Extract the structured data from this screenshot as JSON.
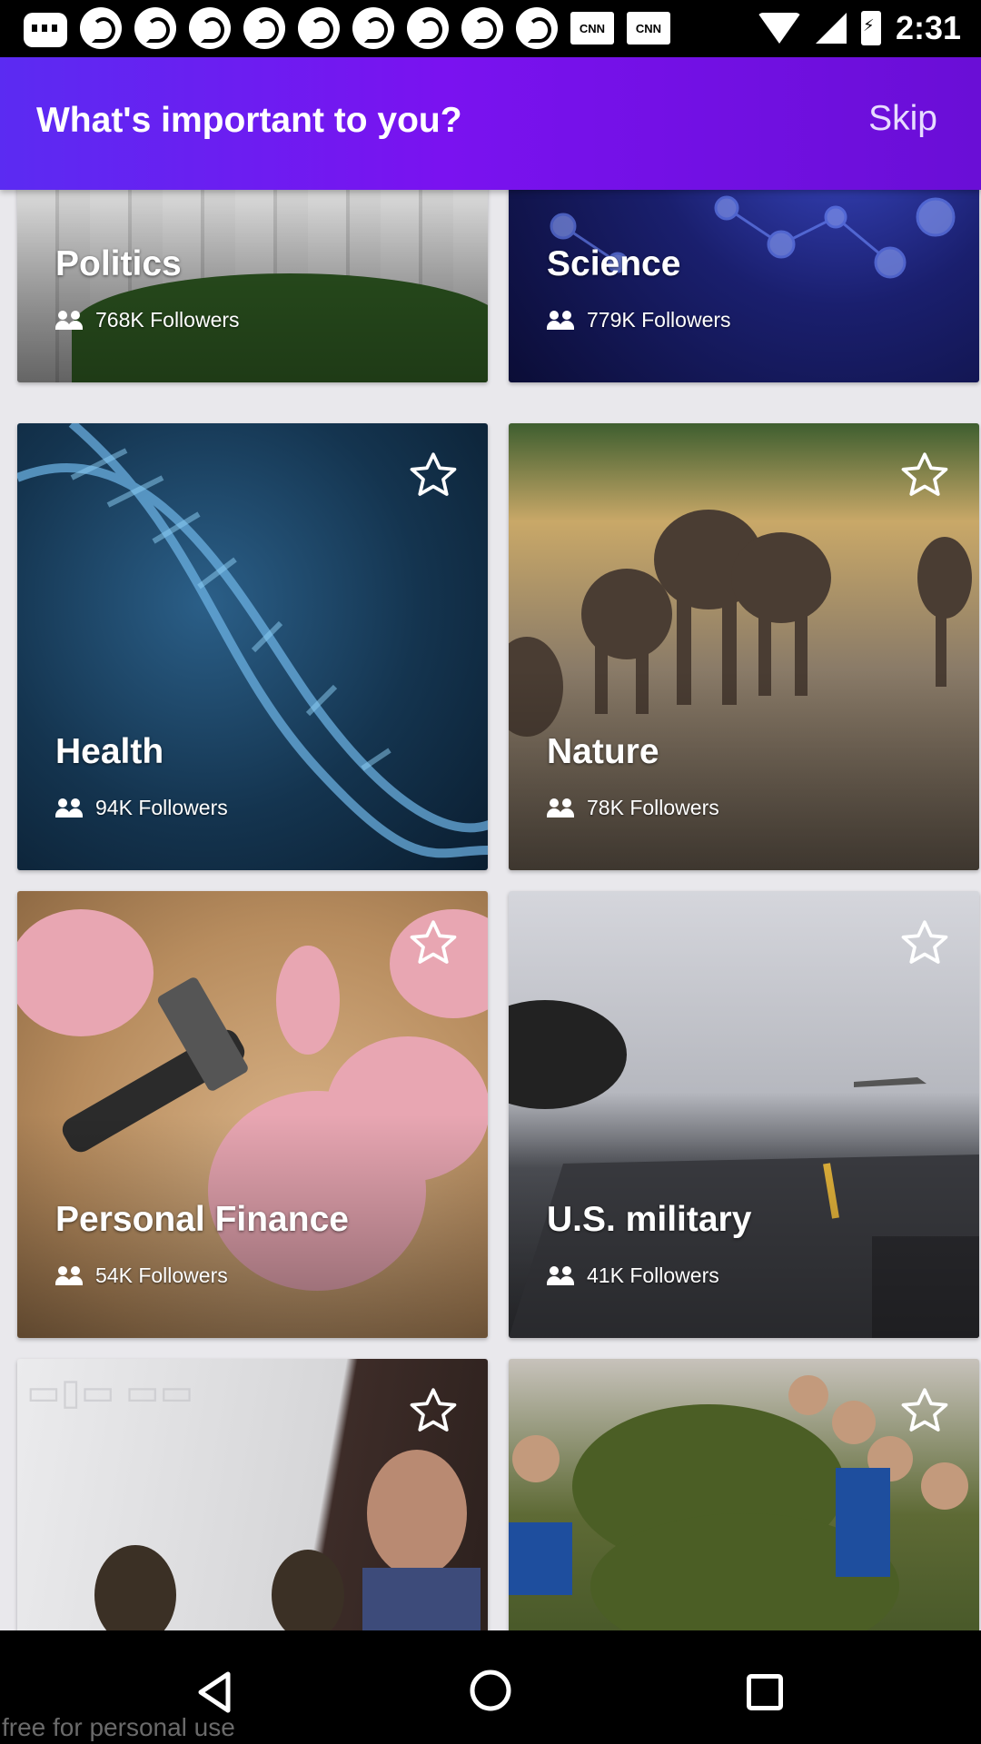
{
  "status_bar": {
    "time": "2:31",
    "notification_icons": [
      "message-icon",
      "podcast-icon",
      "podcast-icon",
      "podcast-icon",
      "podcast-icon",
      "podcast-icon",
      "podcast-icon",
      "podcast-icon",
      "podcast-icon",
      "podcast-icon",
      "cnn-icon",
      "cnn-icon"
    ],
    "cnn_label": "CNN"
  },
  "header": {
    "title": "What's important to you?",
    "skip_label": "Skip"
  },
  "topics": [
    {
      "name": "Politics",
      "followers": "768K Followers",
      "starred": false
    },
    {
      "name": "Science",
      "followers": "779K Followers",
      "starred": false
    },
    {
      "name": "Health",
      "followers": "94K Followers",
      "starred": false
    },
    {
      "name": "Nature",
      "followers": "78K Followers",
      "starred": false
    },
    {
      "name": "Personal Finance",
      "followers": "54K Followers",
      "starred": false
    },
    {
      "name": "U.S. military",
      "followers": "41K Followers",
      "starred": false
    },
    {
      "name": "",
      "followers": "",
      "starred": false
    },
    {
      "name": "",
      "followers": "",
      "starred": false
    }
  ],
  "footer": {
    "watermark": "free for personal use"
  },
  "colors": {
    "header_gradient_start": "#5b2bf2",
    "header_gradient_end": "#6a0ed6",
    "background": "#e9e8ec"
  }
}
